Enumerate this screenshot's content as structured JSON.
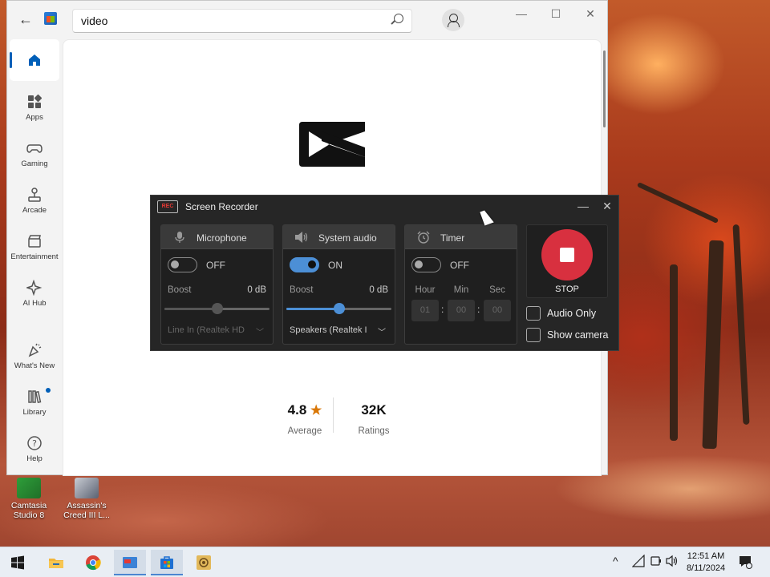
{
  "store": {
    "search_value": "video",
    "nav": [
      {
        "key": "home",
        "label": ""
      },
      {
        "key": "apps",
        "label": "Apps"
      },
      {
        "key": "gaming",
        "label": "Gaming"
      },
      {
        "key": "arcade",
        "label": "Arcade"
      },
      {
        "key": "entertainment",
        "label": "Entertainment"
      },
      {
        "key": "ai-hub",
        "label": "AI Hub"
      },
      {
        "key": "whats-new",
        "label": "What's New"
      },
      {
        "key": "library",
        "label": "Library"
      },
      {
        "key": "help",
        "label": "Help"
      }
    ],
    "rating": {
      "value": "4.8",
      "label": "Average"
    },
    "ratings_count": {
      "value": "32K",
      "label": "Ratings"
    }
  },
  "recorder": {
    "title": "Screen Recorder",
    "logo_text": "REC",
    "microphone": {
      "title": "Microphone",
      "state": "OFF",
      "boost_label": "Boost",
      "boost_value": "0 dB",
      "boost_level": 0.5,
      "device": "Line In (Realtek HD"
    },
    "system_audio": {
      "title": "System audio",
      "state": "ON",
      "boost_label": "Boost",
      "boost_value": "0 dB",
      "boost_level": 0.5,
      "device": "Speakers (Realtek I"
    },
    "timer": {
      "title": "Timer",
      "state": "OFF",
      "hour_label": "Hour",
      "min_label": "Min",
      "sec_label": "Sec",
      "hour": "01",
      "min": "00",
      "sec": "00"
    },
    "stop_label": "STOP",
    "audio_only_label": "Audio Only",
    "show_camera_label": "Show camera"
  },
  "desktop": {
    "icons": [
      {
        "label": "Camtasia Studio 8"
      },
      {
        "label": "Assassin's Creed III L..."
      }
    ]
  },
  "taskbar": {
    "time": "12:51 AM",
    "date": "8/11/2024"
  }
}
